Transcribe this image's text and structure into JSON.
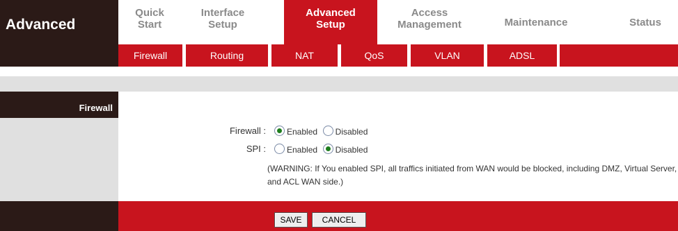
{
  "header": {
    "title": "Advanced"
  },
  "topnav": [
    {
      "label": "Quick\nStart"
    },
    {
      "label": "Interface\nSetup"
    },
    {
      "label": "Advanced\nSetup",
      "active": true
    },
    {
      "label": "Access\nManagement"
    },
    {
      "label": "Maintenance"
    },
    {
      "label": "Status"
    }
  ],
  "subnav": [
    "Firewall",
    "Routing",
    "NAT",
    "QoS",
    "VLAN",
    "ADSL"
  ],
  "section": {
    "title": "Firewall"
  },
  "form": {
    "firewall_label": "Firewall :",
    "spi_label": "SPI :",
    "enabled": "Enabled",
    "disabled": "Disabled",
    "firewall_value": "Enabled",
    "spi_value": "Disabled",
    "warning": "(WARNING: If You enabled SPI, all traffics initiated from WAN would be blocked, including DMZ, Virtual Server, and ACL WAN side.)"
  },
  "buttons": {
    "save": "SAVE",
    "cancel": "CANCEL"
  },
  "colors": {
    "brand_red": "#c8141e",
    "dark": "#2b1a17",
    "grey": "#e0e0e0"
  }
}
